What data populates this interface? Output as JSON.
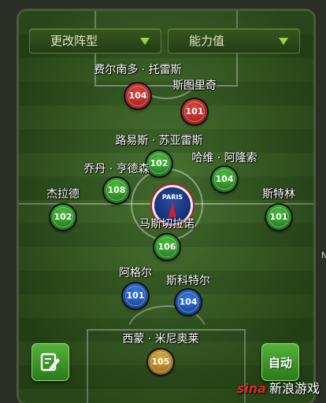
{
  "controls": {
    "formation_label": "更改阵型",
    "attribute_label": "能力值"
  },
  "players": [
    {
      "name": "费尔南多 · 托雷斯",
      "rating": "104",
      "color": "#c0302a"
    },
    {
      "name": "斯图里奇",
      "rating": "101",
      "color": "#c0302a"
    },
    {
      "name": "路易斯 · 苏亚雷斯",
      "rating": "102",
      "color": "#2f9a2a"
    },
    {
      "name": "乔丹 · 亨德森",
      "rating": "108",
      "color": "#2f9a2a"
    },
    {
      "name": "哈维 · 阿隆索",
      "rating": "104",
      "color": "#2f9a2a"
    },
    {
      "name": "杰拉德",
      "rating": "102",
      "color": "#2f9a2a"
    },
    {
      "name": "斯特林",
      "rating": "101",
      "color": "#2f9a2a"
    },
    {
      "name": "马斯切拉诺",
      "rating": "106",
      "color": "#2f9a2a"
    },
    {
      "name": "阿格尔",
      "rating": "101",
      "color": "#1f55b8"
    },
    {
      "name": "斯科特尔",
      "rating": "104",
      "color": "#1f55b8"
    },
    {
      "name": "西蒙 · 米尼奥莱",
      "rating": "105",
      "color": "#c8962d"
    }
  ],
  "club_logo": {
    "text": "PARIS",
    "icon": "club-crest-icon"
  },
  "buttons": {
    "edit_icon": "edit-lineup-icon",
    "auto_label": "自动"
  },
  "watermark": {
    "logo": "sina",
    "text": "新浪游戏"
  },
  "edge_char": "N"
}
